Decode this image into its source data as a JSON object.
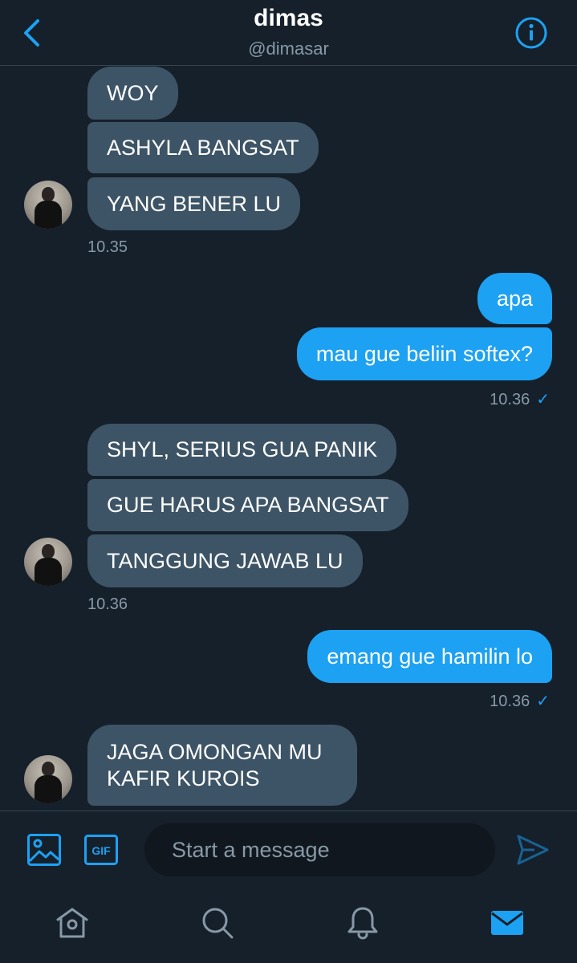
{
  "header": {
    "name": "dimas",
    "handle": "@dimasar"
  },
  "messages": {
    "group1": [
      "WOY",
      "ASHYLA BANGSAT",
      "YANG BENER LU"
    ],
    "group1_time": "10.35",
    "group2": [
      "apa",
      "mau gue beliin softex?"
    ],
    "group2_time": "10.36",
    "group3": [
      "SHYL, SERIUS GUA PANIK",
      "GUE HARUS APA BANGSAT",
      "TANGGUNG JAWAB LU"
    ],
    "group3_time": "10.36",
    "group4": [
      "emang gue hamilin lo"
    ],
    "group4_time": "10.36",
    "group5": [
      "JAGA OMONGAN MU\nKAFIR KUROIS"
    ],
    "read_check": "✓"
  },
  "composer": {
    "placeholder": "Start a message",
    "gif_label": "GIF"
  },
  "colors": {
    "accent": "#1da1f2",
    "background": "#15202b",
    "received_bubble": "#3d5466",
    "muted_text": "#8899a6"
  },
  "icons": {
    "back": "chevron-left-icon",
    "info": "info-icon",
    "image": "image-icon",
    "gif": "gif-icon",
    "send": "send-icon",
    "home": "home-icon",
    "search": "search-icon",
    "notifications": "bell-icon",
    "messages": "mail-icon"
  }
}
